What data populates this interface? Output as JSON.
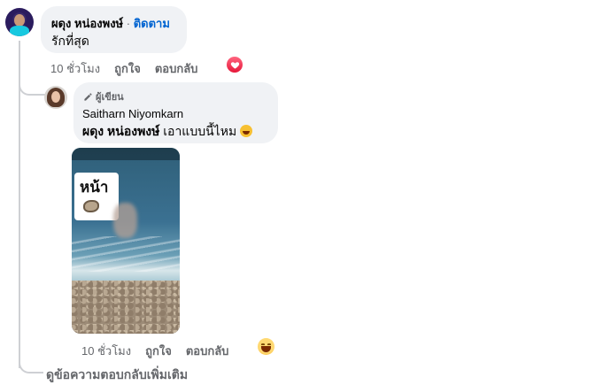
{
  "comment": {
    "author": "ผดุง หน่องพงษ์",
    "separator": "·",
    "follow_label": "ติดตาม",
    "text": "รักที่สุด",
    "time": "10 ชั่วโมง",
    "like_label": "ถูกใจ",
    "reply_label": "ตอบกลับ",
    "reaction_icon": "heart-icon",
    "reaction_color": "#f33e58"
  },
  "reply": {
    "badge_label": "ผู้เขียน",
    "badge_icon": "pencil-icon",
    "author": "Saitharn Niyomkarn",
    "mention": "ผดุง หน่องพงษ์",
    "text": " เอาแบบนี้ไหม",
    "inline_emoji": "rolling-laughing-emoji",
    "attachment_sticker_text": "หน้า",
    "time": "10 ชั่วโมง",
    "like_label": "ถูกใจ",
    "reply_label": "ตอบกลับ",
    "reaction_icon": "laughing-face-icon"
  },
  "more_replies_label": "ดูข้อความตอบกลับเพิ่มเติม",
  "colors": {
    "bubble": "#f0f2f5",
    "link_blue": "#0064d1",
    "secondary_text": "#65676b",
    "thread_line": "#ced0d4"
  }
}
